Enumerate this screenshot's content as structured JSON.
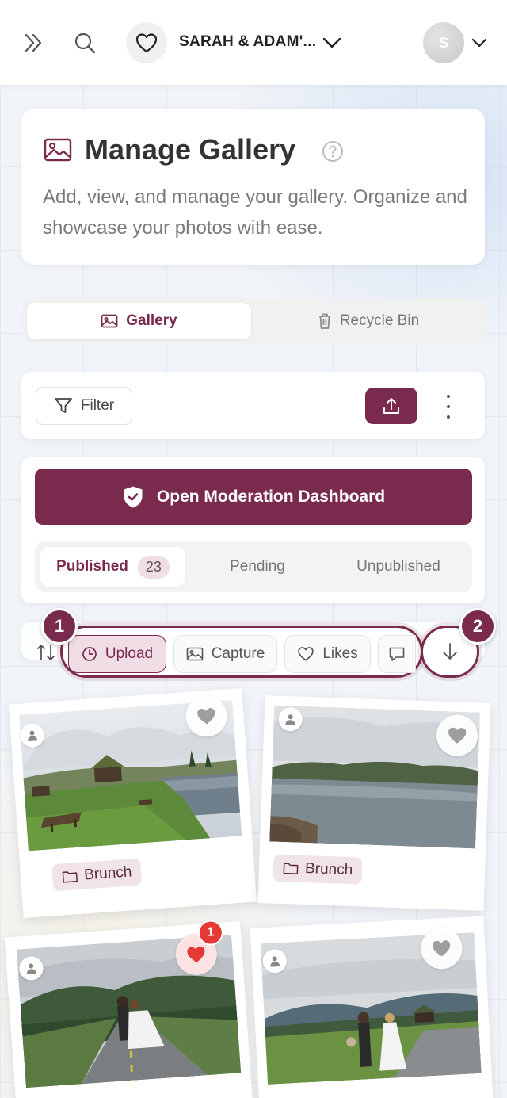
{
  "topbar": {
    "event_name": "SARAH & ADAM'...",
    "avatar_initial": "S"
  },
  "header": {
    "title": "Manage Gallery",
    "description": "Add, view, and manage your gallery. Organize and showcase your photos with ease."
  },
  "main_tabs": [
    {
      "label": "Gallery",
      "active": true
    },
    {
      "label": "Recycle Bin",
      "active": false
    }
  ],
  "toolbar": {
    "filter_label": "Filter"
  },
  "moderation": {
    "button_label": "Open Moderation Dashboard"
  },
  "status_tabs": [
    {
      "label": "Published",
      "count": "23",
      "active": true
    },
    {
      "label": "Pending"
    },
    {
      "label": "Unpublished"
    }
  ],
  "sort": {
    "chips": [
      {
        "label": "Upload",
        "icon": "clock-icon",
        "active": true
      },
      {
        "label": "Capture",
        "icon": "image-icon",
        "active": false
      },
      {
        "label": "Likes",
        "icon": "heart-icon",
        "active": false
      },
      {
        "label": "",
        "icon": "comment-icon",
        "active": false
      }
    ],
    "step_markers": [
      "1",
      "2"
    ]
  },
  "photos": [
    {
      "album": "Brunch",
      "liked": false,
      "scene": "cabin-lake"
    },
    {
      "album": "Brunch",
      "liked": false,
      "scene": "lake"
    },
    {
      "album": "",
      "liked": true,
      "like_count": "1",
      "scene": "couple-road"
    },
    {
      "album": "",
      "liked": false,
      "scene": "couple-field"
    }
  ],
  "colors": {
    "accent": "#7a2a4c",
    "accent_light": "#f1dde5",
    "like_red": "#e53935"
  }
}
